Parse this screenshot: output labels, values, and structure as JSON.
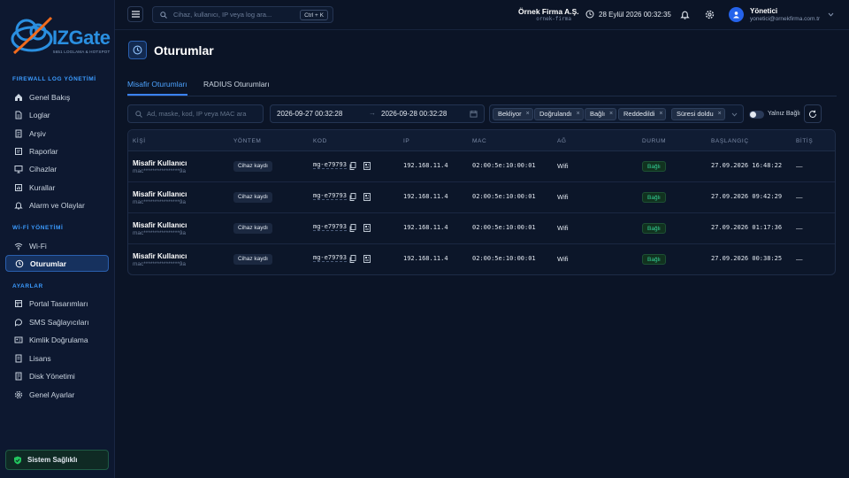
{
  "brand": {
    "name": "IZGate",
    "subtitle": "5651 LOGLAMA & HOTSPOT",
    "colors": {
      "accent": "#3b82f6",
      "success": "#34d399",
      "bg": "#0b1426"
    }
  },
  "sidebar": {
    "sections": [
      {
        "title": "FIREWALL LOG YÖNETİMİ",
        "items": [
          {
            "label": "Genel Bakış",
            "icon": "home-icon"
          },
          {
            "label": "Loglar",
            "icon": "file-icon"
          },
          {
            "label": "Arşiv",
            "icon": "archive-icon"
          },
          {
            "label": "Raporlar",
            "icon": "report-icon"
          },
          {
            "label": "Cihazlar",
            "icon": "monitor-icon"
          },
          {
            "label": "Kurallar",
            "icon": "rules-icon"
          },
          {
            "label": "Alarm ve Olaylar",
            "icon": "bell-icon"
          }
        ]
      },
      {
        "title": "Wİ-Fİ YÖNETİMİ",
        "items": [
          {
            "label": "Wi-Fi",
            "icon": "wifi-icon"
          },
          {
            "label": "Oturumlar",
            "icon": "clock-icon",
            "active": true
          }
        ]
      },
      {
        "title": "AYARLAR",
        "items": [
          {
            "label": "Portal Tasarımları",
            "icon": "layout-icon"
          },
          {
            "label": "SMS Sağlayıcıları",
            "icon": "message-icon"
          },
          {
            "label": "Kimlik Doğrulama",
            "icon": "id-card-icon"
          },
          {
            "label": "Lisans",
            "icon": "license-icon"
          },
          {
            "label": "Disk Yönetimi",
            "icon": "disk-icon"
          },
          {
            "label": "Genel Ayarlar",
            "icon": "gear-icon"
          }
        ]
      }
    ],
    "health_label": "Sistem Sağlıklı"
  },
  "topbar": {
    "search_placeholder": "Cihaz, kullanıcı, IP veya log ara...",
    "shortcut": "Ctrl + K",
    "company_name": "Örnek Firma A.Ş.",
    "company_slug": "ornek-firma",
    "datetime": "28 Eylül 2026 00:32:35",
    "user_name": "Yönetici",
    "user_email": "yonetici@ornekfirma.com.tr"
  },
  "page": {
    "title": "Oturumlar",
    "tabs": [
      {
        "label": "Misafir Oturumları",
        "active": true
      },
      {
        "label": "RADIUS Oturumları",
        "active": false
      }
    ]
  },
  "filters": {
    "search_placeholder": "Ad, maske, kod, IP veya MAC ara",
    "date_from": "2026-09-27 00:32:28",
    "date_arrow": "→",
    "date_to": "2026-09-28 00:32:28",
    "status_chips": [
      "Bekliyor",
      "Doğrulandı",
      "Bağlı",
      "Reddedildi",
      "Süresi doldu"
    ],
    "chip_remove": "×",
    "only_connected_label": "Yalnız Bağlı",
    "only_connected": false
  },
  "table": {
    "columns": [
      "KİŞİ",
      "YÖNTEM",
      "KOD",
      "IP",
      "MAC",
      "AĞ",
      "DURUM",
      "BAŞLANGIÇ",
      "BİTİŞ"
    ],
    "rows": [
      {
        "name": "Misafir Kullanıcı",
        "masked": "mac****************9a",
        "method": "Cihaz kaydı",
        "code": "mg-e79793",
        "ip": "192.168.11.4",
        "mac": "02:00:5e:10:00:01",
        "network": "Wifi",
        "status": "Bağlı",
        "start": "27.09.2026 16:48:22",
        "end": "—"
      },
      {
        "name": "Misafir Kullanıcı",
        "masked": "mac****************9a",
        "method": "Cihaz kaydı",
        "code": "mg-e79793",
        "ip": "192.168.11.4",
        "mac": "02:00:5e:10:00:01",
        "network": "Wifi",
        "status": "Bağlı",
        "start": "27.09.2026 09:42:29",
        "end": "—"
      },
      {
        "name": "Misafir Kullanıcı",
        "masked": "mac****************9a",
        "method": "Cihaz kaydı",
        "code": "mg-e79793",
        "ip": "192.168.11.4",
        "mac": "02:00:5e:10:00:01",
        "network": "Wifi",
        "status": "Bağlı",
        "start": "27.09.2026 01:17:36",
        "end": "—"
      },
      {
        "name": "Misafir Kullanıcı",
        "masked": "mac****************9a",
        "method": "Cihaz kaydı",
        "code": "mg-e79793",
        "ip": "192.168.11.4",
        "mac": "02:00:5e:10:00:01",
        "network": "Wifi",
        "status": "Bağlı",
        "start": "27.09.2026 00:38:25",
        "end": "—"
      }
    ]
  }
}
